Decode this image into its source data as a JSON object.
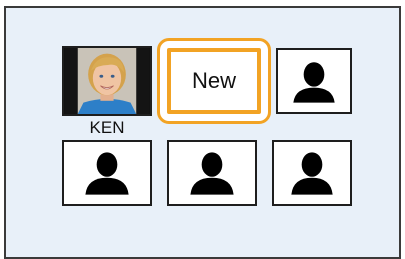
{
  "registered_faces": [
    {
      "name": "KEN"
    }
  ],
  "new_slot": {
    "label": "New",
    "selected": true
  },
  "empty_slots": [
    {
      "icon": "person-silhouette-icon"
    },
    {
      "icon": "person-silhouette-icon"
    },
    {
      "icon": "person-silhouette-icon"
    },
    {
      "icon": "person-silhouette-icon"
    }
  ],
  "colors": {
    "selection": "#f2a324",
    "background": "#e8f0f9",
    "frame": "#1e1e1e"
  }
}
